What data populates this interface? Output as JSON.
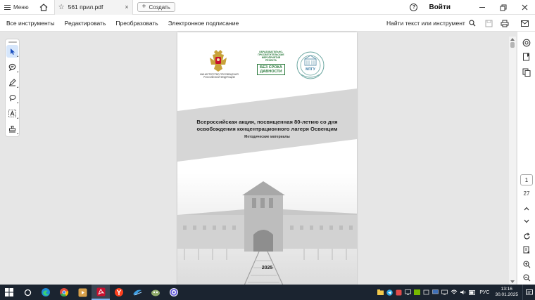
{
  "titlebar": {
    "menu_label": "Меню",
    "tab_title": "561 прил.pdf",
    "tab_close": "×",
    "create_label": "Создать",
    "sign_in": "Войти",
    "help_glyph": "?"
  },
  "menubar": {
    "items": [
      "Все инструменты",
      "Редактировать",
      "Преобразовать",
      "Электронное подписание"
    ],
    "search_label": "Найти текст или инструмент"
  },
  "document": {
    "ministry_text": "МИНИСТЕРСТВО ПРОСВЕЩЕНИЯ РОССИЙСКОЙ ФЕДЕРАЦИИ",
    "project_line1": "ОБРАЗОВАТЕЛЬНО-",
    "project_line2": "ПРОСВЕТИТЕЛЬСКИЕ",
    "project_line3": "МЕРОПРИЯТИЯ ПРОЕКТА",
    "project_badge": "БЕЗ СРОКА ДАВНОСТИ",
    "mpgu_label": "МПГУ",
    "title_line1": "Всероссийская акция, посвященная 80-летию со дня",
    "title_line2": "освобождения концентрационного лагеря Освенцим",
    "subtitle": "Методические материалы",
    "year": "2025"
  },
  "navigation": {
    "current_page": "1",
    "total_pages": "27"
  },
  "taskbar": {
    "language": "РУС",
    "time": "13:16",
    "date": "30.01.2025"
  },
  "colors": {
    "accent": "#1a73e8",
    "taskbar": "#1b2430",
    "project_green": "#2a7a3c",
    "pdf_red": "#c8102e"
  }
}
